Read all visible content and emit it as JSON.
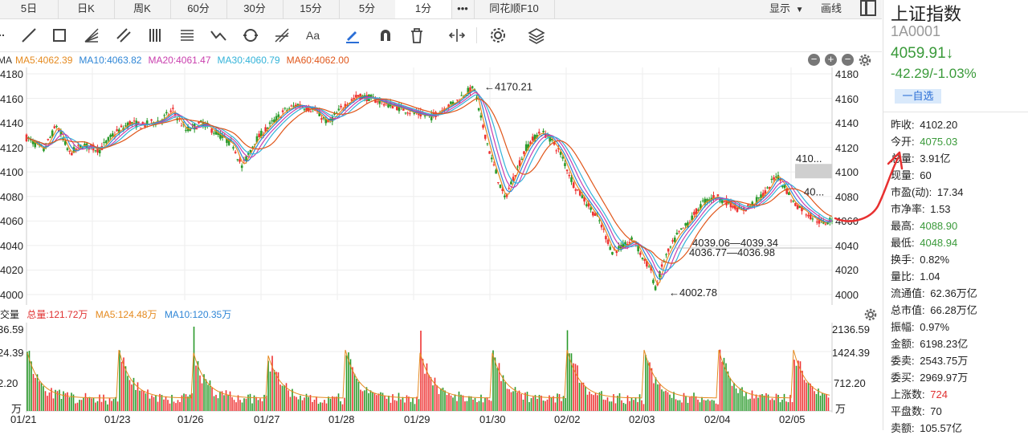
{
  "tabs": [
    {
      "label": "5日",
      "active": false
    },
    {
      "label": "日K",
      "active": false
    },
    {
      "label": "周K",
      "active": false
    },
    {
      "label": "60分",
      "active": false
    },
    {
      "label": "30分",
      "active": false
    },
    {
      "label": "15分",
      "active": false
    },
    {
      "label": "5分",
      "active": false
    },
    {
      "label": "1分",
      "active": true
    },
    {
      "label": "•••",
      "active": false
    },
    {
      "label": "同花顺F10",
      "active": false
    }
  ],
  "tab_right": {
    "display_label": "显示",
    "draw_label": "画线"
  },
  "toolbar_icons": [
    "crosshair-icon",
    "line-icon",
    "rect-icon",
    "fan-icon",
    "parallel-icon",
    "bars-icon",
    "price-range-icon",
    "zigzag-icon",
    "cycle-icon",
    "fib-icon",
    "text-icon",
    "pen-icon",
    "magnet-icon",
    "delete-icon",
    "width-icon",
    "settings-icon",
    "layers-icon"
  ],
  "ma_legend": [
    {
      "label": "MA5:4062.39",
      "color": "#e58a1f"
    },
    {
      "label": "MA10:4063.82",
      "color": "#2f86d6"
    },
    {
      "label": "MA20:4061.47",
      "color": "#c93fae"
    },
    {
      "label": "MA30:4060.79",
      "color": "#33b3d9"
    },
    {
      "label": "MA60:4062.00",
      "color": "#e0561a"
    }
  ],
  "ma_prefix": "MA",
  "price_axis": [
    "4180",
    "4160",
    "4140",
    "4120",
    "4100",
    "4080",
    "4060",
    "4040",
    "4020",
    "4000"
  ],
  "annotations": {
    "high": "←4170.21",
    "low": "←4002.78",
    "fib1": "4039.06—4039.34",
    "fib2": "4036.77—4036.98",
    "box_high": "410...",
    "box_low": "40..."
  },
  "vol_legend": {
    "title": "成交量",
    "total": "总量:121.72万",
    "ma5": "MA5:124.48万",
    "ma10": "MA10:120.35万"
  },
  "vol_axis_left": [
    "36.59",
    "24.39",
    "2.20",
    "万"
  ],
  "vol_axis_right": [
    "2136.59",
    "1424.39",
    "712.20",
    "万"
  ],
  "dates": [
    "01/21",
    "01/23",
    "01/26",
    "01/27",
    "01/28",
    "01/29",
    "01/30",
    "02/02",
    "02/03",
    "02/04",
    "02/05"
  ],
  "panel": {
    "name": "上证指数",
    "code": "1A0001",
    "price": "4059.91↓",
    "change": "-42.29/-1.03%",
    "watch": "一自选",
    "stats": [
      {
        "label": "昨收:",
        "value": "4102.20",
        "tone": ""
      },
      {
        "label": "今开:",
        "value": "4075.03",
        "tone": "green"
      },
      {
        "label": "总量:",
        "value": "3.91亿",
        "tone": ""
      },
      {
        "label": "现量:",
        "value": "60",
        "tone": ""
      },
      {
        "label": "市盈(动):",
        "value": "17.34",
        "tone": ""
      },
      {
        "label": "市净率:",
        "value": "1.53",
        "tone": ""
      },
      {
        "label": "最高:",
        "value": "4088.90",
        "tone": "green"
      },
      {
        "label": "最低:",
        "value": "4048.94",
        "tone": "green"
      },
      {
        "label": "换手:",
        "value": "0.82%",
        "tone": ""
      },
      {
        "label": "量比:",
        "value": "1.04",
        "tone": ""
      },
      {
        "label": "流通值:",
        "value": "62.36万亿",
        "tone": ""
      },
      {
        "label": "总市值:",
        "value": "66.28万亿",
        "tone": ""
      },
      {
        "label": "振幅:",
        "value": "0.97%",
        "tone": ""
      },
      {
        "label": "金额:",
        "value": "6198.23亿",
        "tone": ""
      },
      {
        "label": "委卖:",
        "value": "2543.75万",
        "tone": ""
      },
      {
        "label": "委买:",
        "value": "2969.97万",
        "tone": ""
      },
      {
        "label": "上涨数:",
        "value": "724",
        "tone": "red"
      },
      {
        "label": "平盘数:",
        "value": "70",
        "tone": ""
      },
      {
        "label": "卖额:",
        "value": "105.57亿",
        "tone": ""
      }
    ]
  },
  "chart_data": {
    "type": "line",
    "price_series_key": [
      [
        0,
        4128
      ],
      [
        4,
        4118
      ],
      [
        7,
        4138
      ],
      [
        10,
        4115
      ],
      [
        13,
        4122
      ],
      [
        17,
        4118
      ],
      [
        20,
        4130
      ],
      [
        24,
        4140
      ],
      [
        27,
        4138
      ],
      [
        31,
        4142
      ],
      [
        34,
        4150
      ],
      [
        37,
        4134
      ],
      [
        41,
        4140
      ],
      [
        44,
        4132
      ],
      [
        48,
        4122
      ],
      [
        50,
        4104
      ],
      [
        53,
        4125
      ],
      [
        57,
        4140
      ],
      [
        60,
        4150
      ],
      [
        63,
        4155
      ],
      [
        67,
        4150
      ],
      [
        70,
        4140
      ],
      [
        74,
        4155
      ],
      [
        77,
        4162
      ],
      [
        80,
        4160
      ],
      [
        84,
        4155
      ],
      [
        87,
        4152
      ],
      [
        90,
        4148
      ],
      [
        94,
        4145
      ],
      [
        97,
        4152
      ],
      [
        100,
        4158
      ],
      [
        102,
        4165
      ],
      [
        104,
        4168
      ],
      [
        105,
        4150
      ],
      [
        108,
        4110
      ],
      [
        111,
        4078
      ],
      [
        113,
        4095
      ],
      [
        116,
        4120
      ],
      [
        119,
        4132
      ],
      [
        121,
        4130
      ],
      [
        124,
        4115
      ],
      [
        127,
        4090
      ],
      [
        130,
        4075
      ],
      [
        133,
        4060
      ],
      [
        136,
        4035
      ],
      [
        139,
        4040
      ],
      [
        141,
        4045
      ],
      [
        143,
        4030
      ],
      [
        145,
        4020
      ],
      [
        146,
        4004
      ],
      [
        148,
        4028
      ],
      [
        151,
        4048
      ],
      [
        154,
        4060
      ],
      [
        157,
        4075
      ],
      [
        160,
        4080
      ],
      [
        163,
        4075
      ],
      [
        166,
        4068
      ],
      [
        169,
        4075
      ],
      [
        172,
        4085
      ],
      [
        174,
        4098
      ],
      [
        176,
        4088
      ],
      [
        178,
        4075
      ],
      [
        180,
        4070
      ],
      [
        182,
        4064
      ],
      [
        185,
        4058
      ],
      [
        187,
        4062
      ]
    ],
    "ylim": [
      4000,
      4180
    ],
    "x_categories": [
      "01/21",
      "01/23",
      "01/26",
      "01/27",
      "01/28",
      "01/29",
      "01/30",
      "02/02",
      "02/03",
      "02/04",
      "02/05"
    ],
    "volume_peaks": [
      2136.59,
      1424.39,
      712.2
    ]
  }
}
